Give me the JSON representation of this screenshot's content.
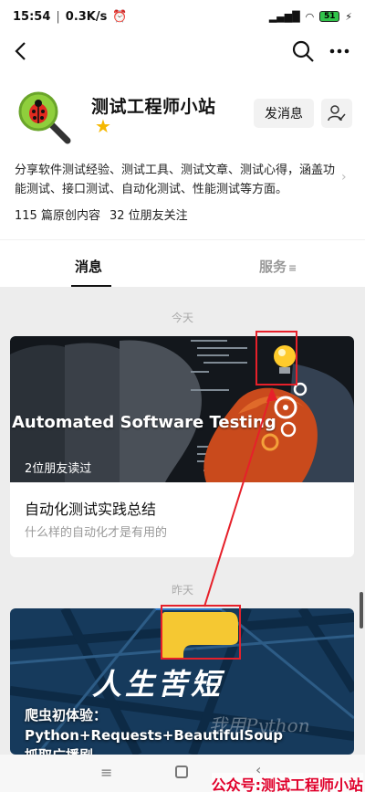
{
  "status": {
    "time": "15:54",
    "speed": "0.3K/s",
    "battery": "51"
  },
  "account": {
    "name": "测试工程师小站",
    "intro": "分享软件测试经验、测试工具、测试文章、测试心得，涵盖功能测试、接口测试、自动化测试、性能测试等方面。",
    "original_count": "115 篇原创内容",
    "friends_follow": "32 位朋友关注",
    "message_button": "发消息"
  },
  "tabs": {
    "messages": "消息",
    "services": "服务"
  },
  "feed": {
    "date_today": "今天",
    "date_yesterday": "昨天",
    "article1": {
      "cover_text": "Automated Software Testing",
      "read_count": "2位朋友读过",
      "title": "自动化测试实践总结",
      "subtitle": "什么样的自动化才是有用的"
    },
    "article2": {
      "cover_calligraphy": "人生苦短",
      "cover_watermark": "我用Python",
      "title": "爬虫初体验：Python+Requests+BeautifulSoup 抓取广播剧"
    }
  },
  "footer": {
    "label": "公众号:测试工程师小站"
  },
  "colors": {
    "accent": "#e6202a",
    "star": "#f5b800",
    "battery": "#31c44b"
  },
  "icons": [
    "back-icon",
    "search-icon",
    "more-icon",
    "ladybug-magnifier-avatar",
    "star-icon",
    "follow-user-icon",
    "lightbulb-icon",
    "gear-icon",
    "python-logo-icon",
    "chevron-right-icon"
  ]
}
